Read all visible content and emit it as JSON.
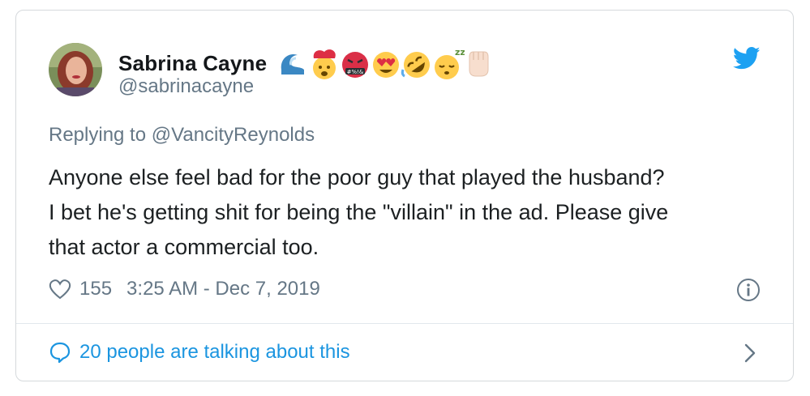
{
  "tweet": {
    "author": {
      "display_name": "Sabrina Cayne",
      "handle": "@sabrinacayne",
      "name_emojis": [
        "wave",
        "exploding-head",
        "cursing-face",
        "heart-eyes",
        "rofl",
        "sleeping-face",
        "raised-fist"
      ]
    },
    "reply_prefix": "Replying to ",
    "reply_mention": "@VancityReynolds",
    "text_lines": [
      "Anyone else feel bad for the poor guy that played the husband?",
      "I bet he's getting shit for being the \"villain\" in the ad. Please give",
      "that actor a commercial too."
    ],
    "likes": "155",
    "timestamp": "3:25 AM - Dec 7, 2019",
    "conversation_link": "20 people are talking about this"
  },
  "colors": {
    "twitter_blue": "#1da1f2",
    "link_blue": "#1b95e0",
    "secondary_text": "#657786",
    "border": "#d5d9dc"
  },
  "icons": [
    "twitter-bird-icon",
    "heart-icon",
    "info-icon",
    "speech-bubble-icon",
    "chevron-right-icon"
  ]
}
